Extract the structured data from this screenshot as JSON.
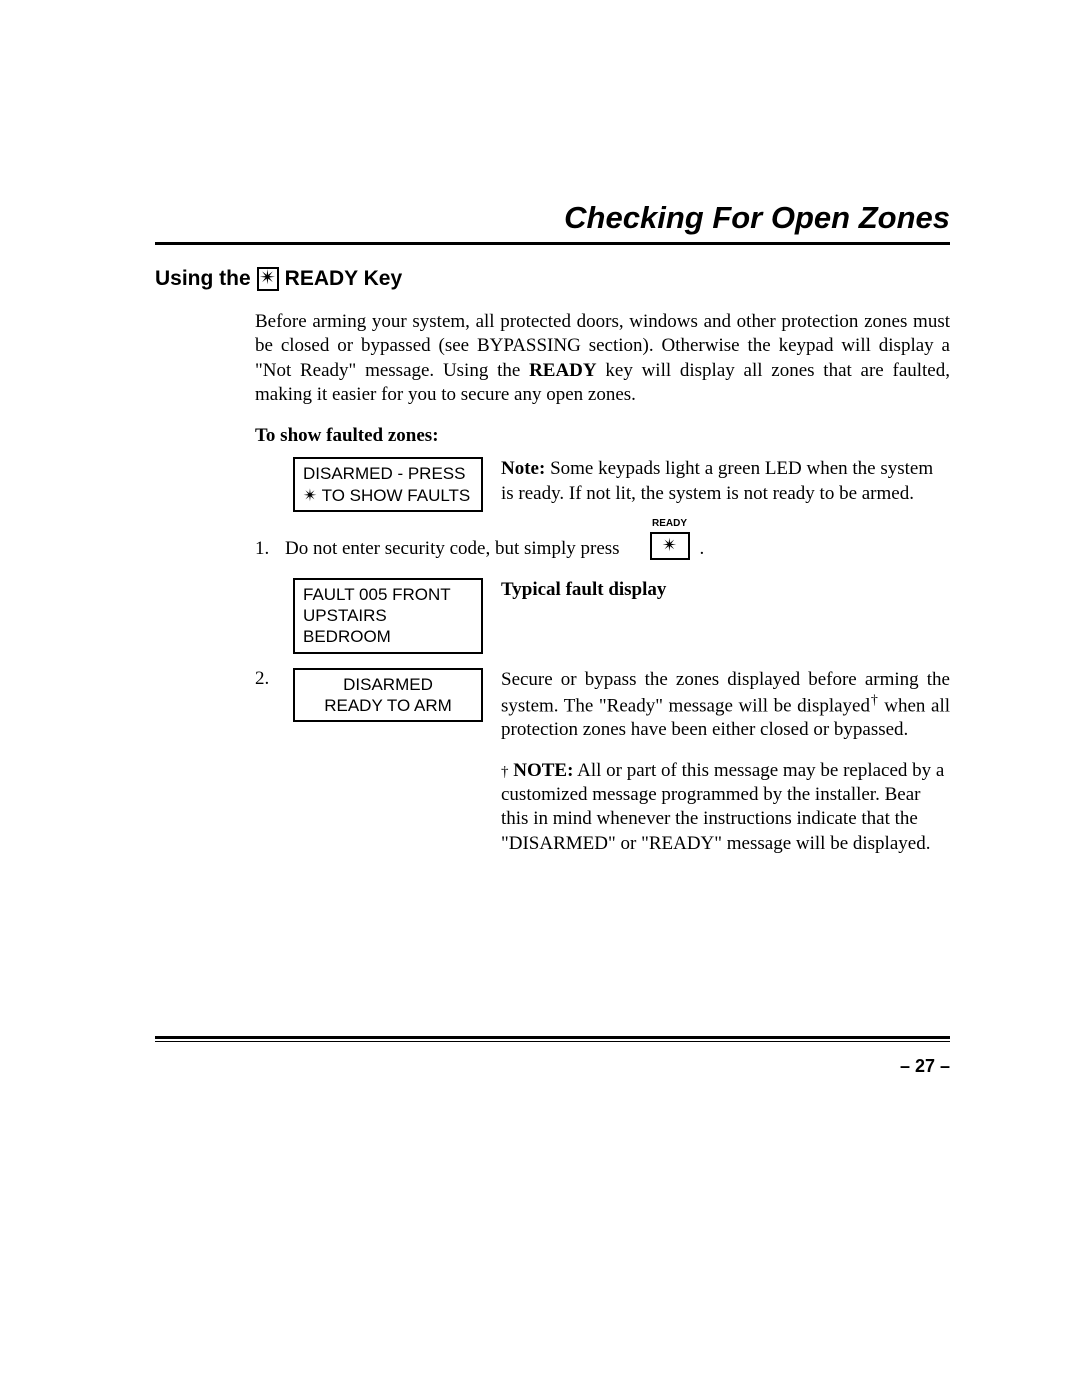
{
  "title": "Checking For Open Zones",
  "heading": {
    "prefix": "Using the",
    "key_glyph": "✴",
    "suffix": " READY Key"
  },
  "intro": {
    "part1": "Before arming your system, all protected doors, windows and other protection zones must be closed or bypassed (see BYPASSING section).  Otherwise the keypad will display a \"Not Ready\" message. Using the ",
    "bold": "READY",
    "part2": " key will display all zones that are faulted, making it easier for you to secure any open zones."
  },
  "subhead": "To show faulted zones:",
  "lcd1": {
    "line1": "DISARMED - PRESS",
    "line2": "✴ TO SHOW FAULTS"
  },
  "note1": {
    "bold": "Note:",
    "text": " Some keypads light a green LED when the system is ready. If not lit, the system is not ready to be armed."
  },
  "step1": {
    "num": "1.",
    "text": "Do not enter security code, but simply press",
    "ready_label": "READY",
    "key_glyph": "✴",
    "period": "."
  },
  "lcd2": {
    "line1": "FAULT  005  FRONT",
    "line2": "UPSTAIRS BEDROOM"
  },
  "typical_label": "Typical fault display",
  "step2_num": "2.",
  "lcd3": {
    "line1": "DISARMED",
    "line2": "READY TO ARM"
  },
  "step2_text": {
    "part1": "Secure or bypass the zones displayed before arming the system. The \"Ready\" message will be displayed",
    "dagger": "†",
    "part2": " when all protection zones have been either closed or bypassed."
  },
  "note2": {
    "dagger": "†",
    "bold": " NOTE:",
    "text": " All or part of this message may be replaced by a customized message programmed by the installer.  Bear this in mind whenever the instructions indicate that the \"DISARMED\" or \"READY\" message will be displayed."
  },
  "page_number": "– 27 –"
}
